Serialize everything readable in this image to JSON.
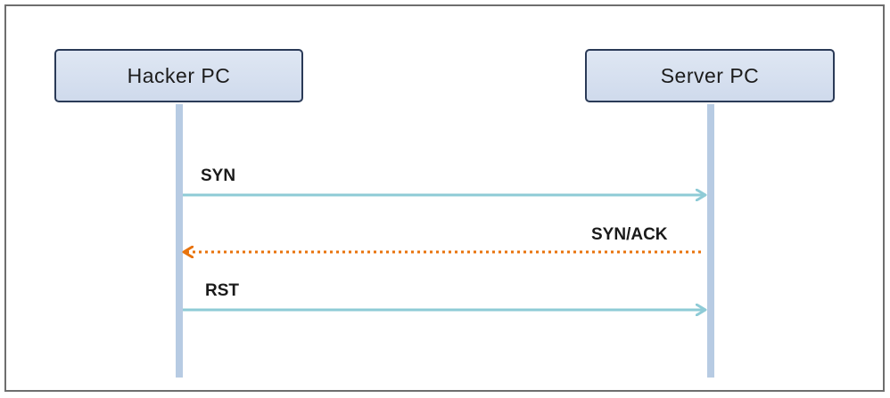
{
  "actors": {
    "hacker": "Hacker PC",
    "server": "Server PC"
  },
  "messages": [
    {
      "label": "SYN",
      "from": "Hacker PC",
      "to": "Server PC",
      "style": "solid",
      "color": "#8ecbd6"
    },
    {
      "label": "SYN/ACK",
      "from": "Server PC",
      "to": "Hacker PC",
      "style": "dotted",
      "color": "#e8730c"
    },
    {
      "label": "RST",
      "from": "Hacker PC",
      "to": "Server PC",
      "style": "solid",
      "color": "#8ecbd6"
    }
  ],
  "colors": {
    "lifeline": "#b7cbe3",
    "box_border": "#2a3a57",
    "box_fill": "#d6e0ef",
    "frame_border": "#6e6e6e"
  }
}
